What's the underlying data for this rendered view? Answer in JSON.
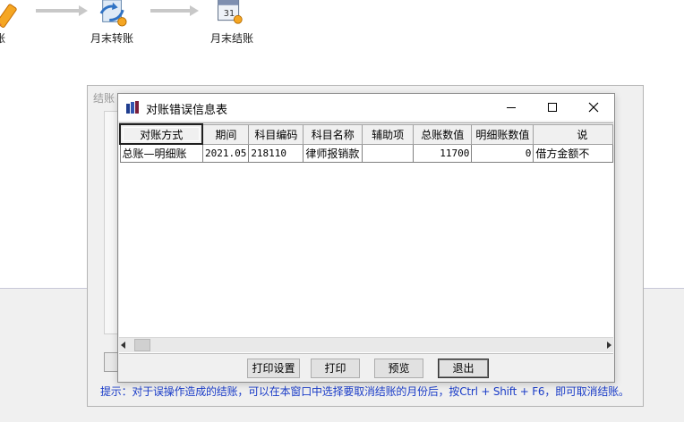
{
  "flow": {
    "items": [
      {
        "label": "账",
        "icon": "pencil-icon"
      },
      {
        "label": "月末转账",
        "icon": "transfer-doc-icon"
      },
      {
        "label": "月末结账",
        "icon": "calendar-icon"
      }
    ]
  },
  "back_dialog": {
    "title": "结账",
    "hint": "提示：对于误操作造成的结账，可以在本窗口中选择要取消结账的月份后，按Ctrl + Shift + F6，即可取消结账。"
  },
  "window": {
    "title": "对账错误信息表",
    "minimize": "minimize-icon",
    "maximize": "maximize-icon",
    "close": "close-icon"
  },
  "grid": {
    "columns": [
      "对账方式",
      "期间",
      "科目编码",
      "科目名称",
      "辅助项",
      "总账数值",
      "明细账数值",
      "说"
    ],
    "rows": [
      [
        "总账—明细账",
        "2021.05",
        "218110",
        "律师报销款",
        "",
        "11700",
        "0",
        "借方金额不"
      ]
    ]
  },
  "buttons": {
    "print_setup": "打印设置",
    "print": "打印",
    "preview": "预览",
    "exit": "退出"
  },
  "colors": {
    "hint_text": "#1a3cc8",
    "window_bg": "#f0f0f0"
  }
}
